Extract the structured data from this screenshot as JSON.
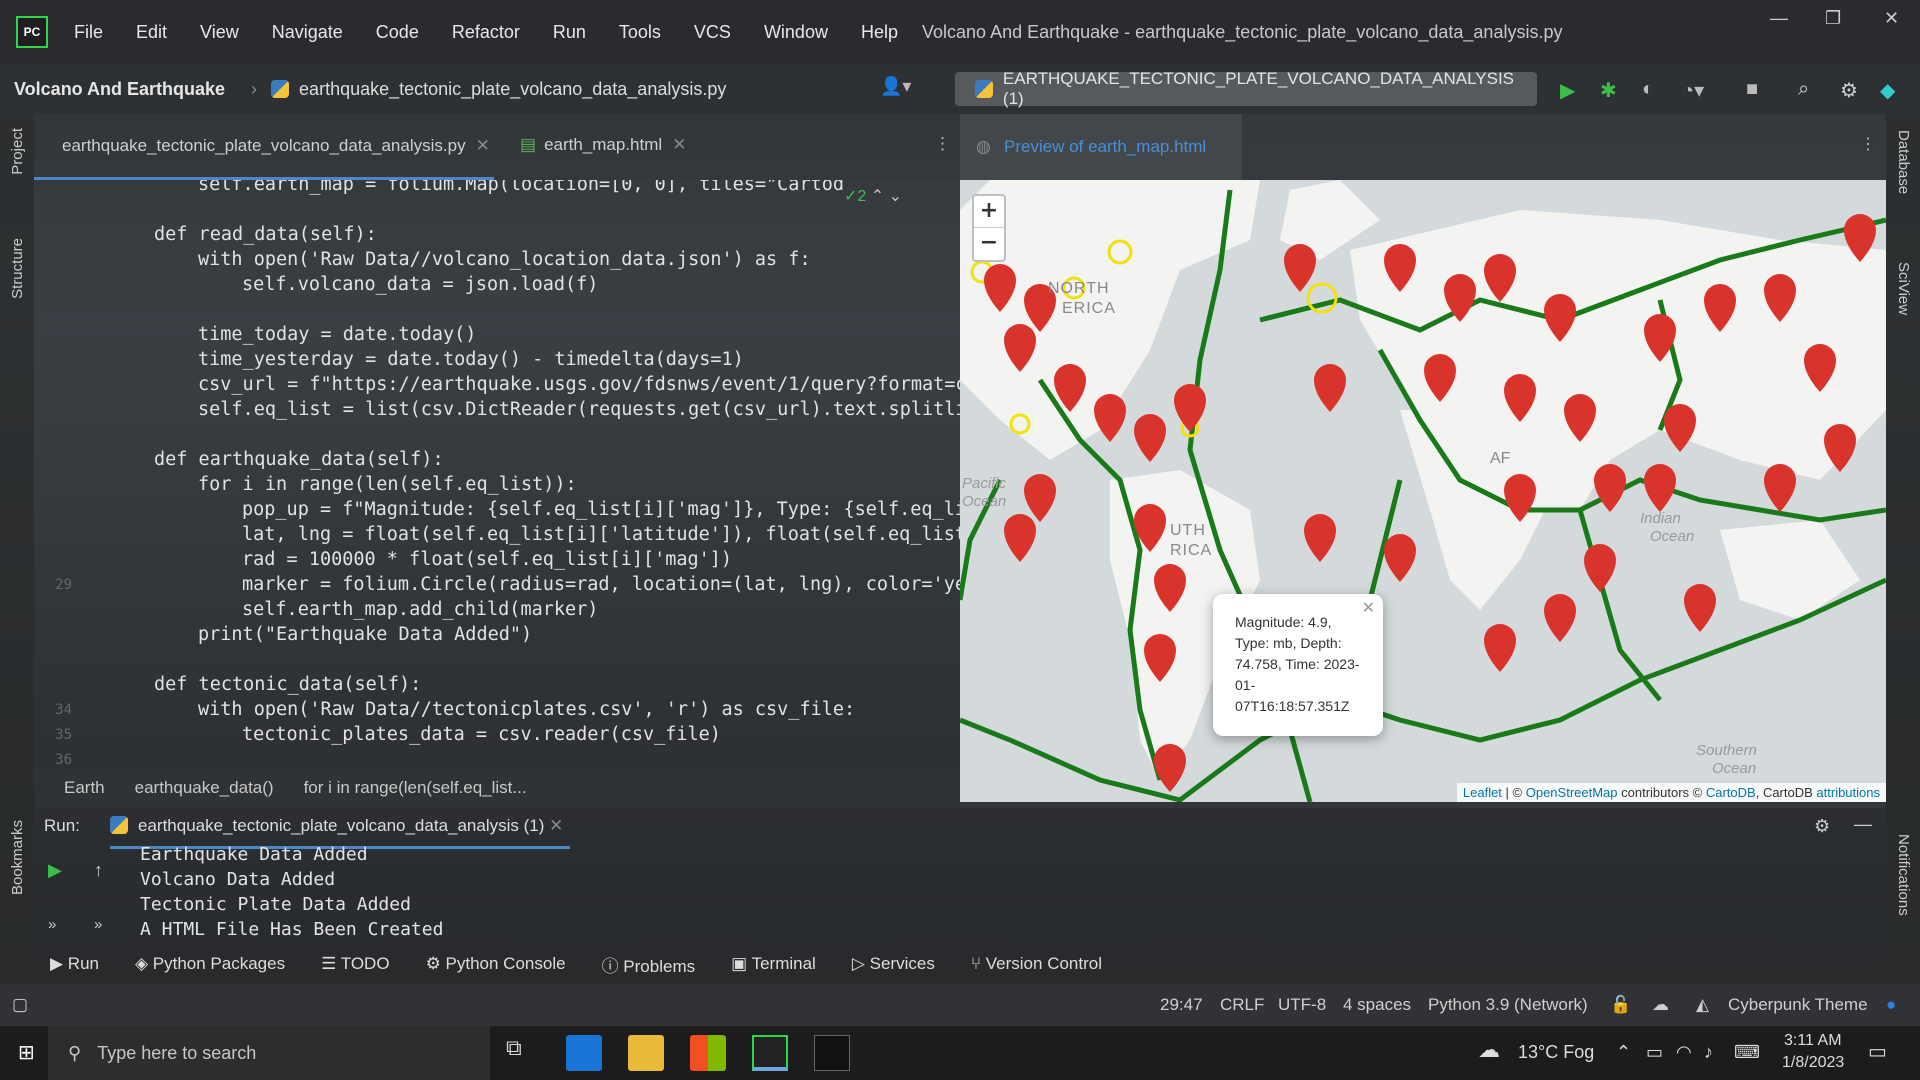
{
  "menubar": {
    "logo": "PC",
    "items": [
      "File",
      "Edit",
      "View",
      "Navigate",
      "Code",
      "Refactor",
      "Run",
      "Tools",
      "VCS",
      "Window",
      "Help"
    ],
    "title": "Volcano And Earthquake - earthquake_tectonic_plate_volcano_data_analysis.py",
    "controls": [
      "—",
      "❐",
      "✕"
    ]
  },
  "navbar": {
    "project": "Volcano And Earthquake",
    "file": "earthquake_tectonic_plate_volcano_data_analysis.py",
    "run_config": "EARTHQUAKE_TECTONIC_PLATE_VOLCANO_DATA_ANALYSIS (1)"
  },
  "sidebar_left": {
    "project": "Project",
    "structure": "Structure",
    "bookmarks": "Bookmarks"
  },
  "sidebar_right": {
    "database": "Database",
    "sciview": "SciView",
    "notifications": "Notifications"
  },
  "editor": {
    "tabs": [
      {
        "label": "earthquake_tectonic_plate_volcano_data_analysis.py"
      },
      {
        "label": "earth_map.html"
      }
    ],
    "inspection": "✓2",
    "lines": [
      {
        "n": "",
        "i": 1,
        "t": "self.earth_map = folium.Map(location=[0, 0], tiles=\"Cartod"
      },
      {
        "n": "",
        "i": 0,
        "t": ""
      },
      {
        "n": "",
        "i": 0,
        "t": "def read_data(self):"
      },
      {
        "n": "",
        "i": 1,
        "t": "with open('Raw Data//volcano_location_data.json') as f:"
      },
      {
        "n": "",
        "i": 2,
        "t": "self.volcano_data = json.load(f)"
      },
      {
        "n": "",
        "i": 0,
        "t": ""
      },
      {
        "n": "",
        "i": 1,
        "t": "time_today = date.today()"
      },
      {
        "n": "",
        "i": 1,
        "t": "time_yesterday = date.today() - timedelta(days=1)"
      },
      {
        "n": "",
        "i": 1,
        "t": "csv_url = f\"https://earthquake.usgs.gov/fdsnws/event/1/query?format=c"
      },
      {
        "n": "",
        "i": 1,
        "t": "self.eq_list = list(csv.DictReader(requests.get(csv_url).text.splitli"
      },
      {
        "n": "",
        "i": 0,
        "t": ""
      },
      {
        "n": "",
        "i": 0,
        "t": "def earthquake_data(self):"
      },
      {
        "n": "",
        "i": 1,
        "t": "for i in range(len(self.eq_list)):"
      },
      {
        "n": "",
        "i": 2,
        "t": "pop_up = f\"Magnitude: {self.eq_list[i]['mag']}, Type: {self.eq_li"
      },
      {
        "n": "",
        "i": 2,
        "t": "lat, lng = float(self.eq_list[i]['latitude']), float(self.eq_list"
      },
      {
        "n": "",
        "i": 2,
        "t": "rad = 100000 * float(self.eq_list[i]['mag'])"
      },
      {
        "n": "29",
        "i": 2,
        "t": "marker = folium.Circle(radius=rad, location=(lat, lng), color='ye"
      },
      {
        "n": "",
        "i": 2,
        "t": "self.earth_map.add_child(marker)"
      },
      {
        "n": "",
        "i": 1,
        "t": "print(\"Earthquake Data Added\")"
      },
      {
        "n": "",
        "i": 0,
        "t": ""
      },
      {
        "n": "",
        "i": 0,
        "t": "def tectonic_data(self):"
      },
      {
        "n": "34",
        "i": 1,
        "t": "with open('Raw Data//tectonicplates.csv', 'r') as csv_file:"
      },
      {
        "n": "35",
        "i": 2,
        "t": "tectonic_plates_data = csv.reader(csv_file)"
      },
      {
        "n": "36",
        "i": 0,
        "t": ""
      }
    ],
    "breadcrumb": [
      "Earth",
      "earthquake_data()",
      "for i in range(len(self.eq_list..."
    ]
  },
  "preview": {
    "tab": "Preview of earth_map.html",
    "labels": [
      "NORTH",
      "ERICA",
      "UTH",
      "RICA",
      "Pacific",
      "Ocean",
      "AF",
      "Indian",
      "Ocean",
      "Southern",
      "Ocean"
    ],
    "popup": "Magnitude: 4.9, Type: mb, Depth: 74.758, Time: 2023-01-07T16:18:57.351Z",
    "attribution": {
      "leaflet": "Leaflet",
      "sep": " | © ",
      "osm": "OpenStreetMap",
      "mid": " contributors © ",
      "carto": "CartoDB",
      "tail": ", CartoDB ",
      "attr": "attributions"
    },
    "zoom_in": "+",
    "zoom_out": "−"
  },
  "run": {
    "label": "Run:",
    "tab": "earthquake_tectonic_plate_volcano_data_analysis (1)",
    "output": [
      "Earthquake Data Added",
      "Volcano Data Added",
      "Tectonic Plate Data Added",
      "A HTML File Has Been Created"
    ]
  },
  "toolwindows": [
    "Run",
    "Python Packages",
    "TODO",
    "Python Console",
    "Problems",
    "Terminal",
    "Services",
    "Version Control"
  ],
  "statusbar": {
    "position": "29:47",
    "line_sep": "CRLF",
    "encoding": "UTF-8",
    "indent": "4 spaces",
    "interpreter": "Python 3.9 (Network)",
    "theme": "Cyberpunk Theme"
  },
  "taskbar": {
    "search": "Type here to search",
    "weather": "13°C Fog",
    "time": "3:11 AM",
    "date": "1/8/2023"
  },
  "colors": {
    "accent": "#4a88c7",
    "marker": "#d9342b",
    "plate": "#1a7a1a",
    "volcano": "#f2e20a"
  }
}
